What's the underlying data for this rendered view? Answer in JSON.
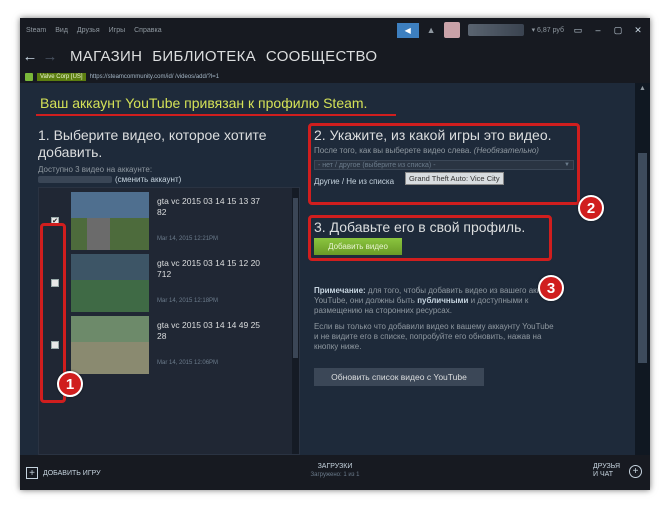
{
  "titlebar": {
    "menu": [
      "Steam",
      "Вид",
      "Друзья",
      "Игры",
      "Справка"
    ],
    "wallet": "▾ 6,87 руб",
    "controls": [
      "▭",
      "–",
      "▢",
      "✕"
    ]
  },
  "nav": {
    "back": "←",
    "forward": "→",
    "links": [
      "МАГАЗИН",
      "БИБЛИОТЕКА",
      "СООБЩЕСТВО"
    ]
  },
  "urlbar": {
    "cert": "Valve Corp [US]",
    "url": "https://steamcommunity.com/id/            /videos/add/?l=1"
  },
  "banner": "Ваш аккаунт YouTube привязан к профилю Steam.",
  "step1": {
    "title": "1. Выберите видео, которое хотите добавить.",
    "available": "Доступно 3 видео на аккаунте:",
    "change_account": "(сменить аккаунт)"
  },
  "videos": [
    {
      "title": "gta vc 2015 03 14 15 13 37 82",
      "date": "Mar 14, 2015 12:21PM",
      "checked": "✔"
    },
    {
      "title": "gta vc 2015 03 14 15 12 20 712",
      "date": "Mar 14, 2015 12:18PM",
      "checked": ""
    },
    {
      "title": "gta vc 2015 03 14 14 49 25 28",
      "date": "Mar 14, 2015 12:06PM",
      "checked": ""
    }
  ],
  "step2": {
    "title": "2. Укажите, из какой игры это видео.",
    "hint": "После того, как вы выберете видео слева.",
    "hint_optional": "(Необязательно)",
    "select_placeholder": "- нет / другое (выберите из списка) -",
    "other": "Другие / Не из списка",
    "tooltip": "Grand Theft Auto: Vice City"
  },
  "step3": {
    "title": "3. Добавьте его в свой профиль.",
    "add_button": "Добавить видео"
  },
  "note": {
    "label": "Примечание:",
    "text1": " для того, чтобы добавить видео из вашего аккаунта YouTube, они должны быть ",
    "bold1": "публичными",
    "text2": " и доступными к размещению на сторонних ресурсах.",
    "text3": "Если вы только что добавили видео к вашему аккаунту YouTube и не видите его в списке, попробуйте его обновить, нажав на кнопку ниже.",
    "refresh_button": "Обновить список видео с YouTube"
  },
  "badges": [
    "1",
    "2",
    "3"
  ],
  "footer": {
    "add_game": "ДОБАВИТЬ ИГРУ",
    "downloads": "ЗАГРУЗКИ",
    "downloads_sub": "Загружено: 1 из 1",
    "friends": "ДРУЗЬЯ И ЧАТ"
  }
}
